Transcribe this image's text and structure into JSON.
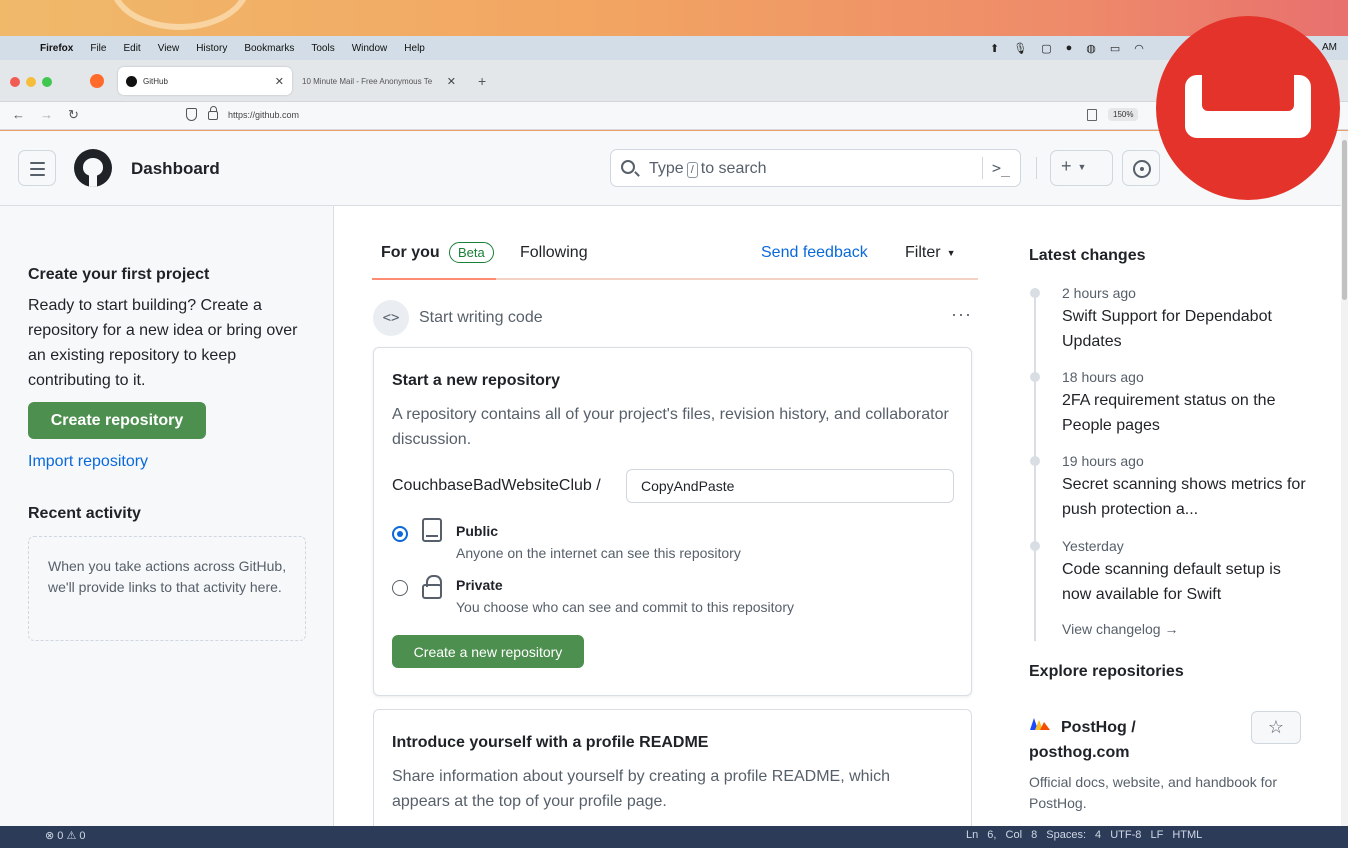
{
  "menubar": {
    "items": [
      "Firefox",
      "File",
      "Edit",
      "View",
      "History",
      "Bookmarks",
      "Tools",
      "Window",
      "Help"
    ],
    "clock": "AM"
  },
  "browser": {
    "tabs": [
      {
        "title": "GitHub"
      },
      {
        "title": "10 Minute Mail - Free Anonymous Te"
      }
    ],
    "url": "https://github.com",
    "zoom": "150%"
  },
  "header": {
    "title": "Dashboard",
    "search_prefix": "Type",
    "search_key": "/",
    "search_suffix": "to search",
    "cmd": ">_",
    "new_plus": "+"
  },
  "left": {
    "create_heading": "Create your first project",
    "create_text": "Ready to start building? Create a repository for a new idea or bring over an existing repository to keep contributing to it.",
    "create_button": "Create repository",
    "import_link": "Import repository",
    "recent_heading": "Recent activity",
    "recent_text": "When you take actions across GitHub, we'll provide links to that activity here."
  },
  "feed": {
    "tab_foryou": "For you",
    "beta": "Beta",
    "tab_following": "Following",
    "send_feedback": "Send feedback",
    "filter": "Filter",
    "start_writing": "Start writing code",
    "code_icon": "<>",
    "more": "···",
    "new_repo_card": {
      "title": "Start a new repository",
      "desc": "A repository contains all of your project's files, revision history, and collaborator discussion.",
      "owner": "CouchbaseBadWebsiteClub /",
      "repo_name": "CopyAndPaste",
      "public_label": "Public",
      "public_desc": "Anyone on the internet can see this repository",
      "private_label": "Private",
      "private_desc": "You choose who can see and commit to this repository",
      "button": "Create a new repository",
      "selected_visibility": "public"
    },
    "readme_card": {
      "title": "Introduce yourself with a profile README",
      "desc": "Share information about yourself by creating a profile README, which appears at the top of your profile page."
    }
  },
  "right": {
    "latest_heading": "Latest changes",
    "changes": [
      {
        "time": "2 hours ago",
        "title": "Swift Support for Dependabot Updates"
      },
      {
        "time": "18 hours ago",
        "title": "2FA requirement status on the People pages"
      },
      {
        "time": "19 hours ago",
        "title": "Secret scanning shows metrics for push protection a..."
      },
      {
        "time": "Yesterday",
        "title": "Code scanning default setup is now available for Swift"
      }
    ],
    "view_changelog": "View changelog →",
    "explore_heading": "Explore repositories",
    "explore_repo": {
      "name": "PostHog / posthog.com",
      "desc": "Official docs, website, and handbook for PostHog.",
      "star": "☆"
    }
  },
  "statusbar": {
    "left": "⊗ 0 ⚠ 0",
    "right": "Ln 6, Col 8   Spaces: 4   UTF-8   LF   HTML"
  },
  "colors": {
    "green_button": "#4d8f4f",
    "link_blue": "#0969da",
    "overlay_red": "#e4332a",
    "tab_active_underline": "#fd8c73"
  }
}
